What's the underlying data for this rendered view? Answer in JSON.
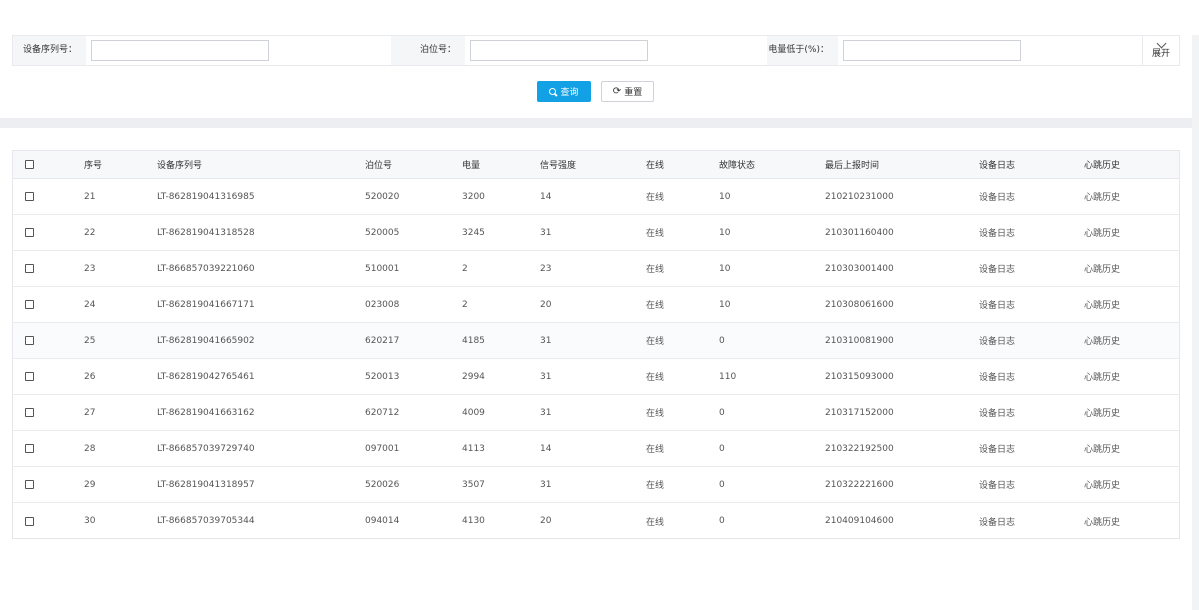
{
  "filters": {
    "serial_label": "设备序列号：",
    "serial_value": "",
    "berth_label": "泊位号：",
    "berth_value": "",
    "battery_label": "电量低于(%)：",
    "battery_value": "",
    "expand_label": "展开",
    "expand_icon": "chevron-down-icon"
  },
  "actions": {
    "query_label": "查询",
    "query_icon": "search-icon",
    "reset_label": "重置",
    "reset_icon": "refresh-icon",
    "reset_glyph": "⟳"
  },
  "colors": {
    "primary": "#11a1e4",
    "header_bg": "#f7f8fa",
    "band_bg": "#eceef2"
  },
  "table": {
    "headers": [
      "序号",
      "设备序列号",
      "泊位号",
      "电量",
      "信号强度",
      "在线",
      "故障状态",
      "最后上报时间",
      "设备日志",
      "心跳历史"
    ],
    "rows": [
      [
        "21",
        "LT-862819041316985",
        "520020",
        "3200",
        "14",
        "在线",
        "10",
        "210210231000",
        "设备日志",
        "心跳历史"
      ],
      [
        "22",
        "LT-862819041318528",
        "520005",
        "3245",
        "31",
        "在线",
        "10",
        "210301160400",
        "设备日志",
        "心跳历史"
      ],
      [
        "23",
        "LT-866857039221060",
        "510001",
        "2",
        "23",
        "在线",
        "10",
        "210303001400",
        "设备日志",
        "心跳历史"
      ],
      [
        "24",
        "LT-862819041667171",
        "023008",
        "2",
        "20",
        "在线",
        "10",
        "210308061600",
        "设备日志",
        "心跳历史"
      ],
      [
        "25",
        "LT-862819041665902",
        "620217",
        "4185",
        "31",
        "在线",
        "0",
        "210310081900",
        "设备日志",
        "心跳历史"
      ],
      [
        "26",
        "LT-862819042765461",
        "520013",
        "2994",
        "31",
        "在线",
        "110",
        "210315093000",
        "设备日志",
        "心跳历史"
      ],
      [
        "27",
        "LT-862819041663162",
        "620712",
        "4009",
        "31",
        "在线",
        "0",
        "210317152000",
        "设备日志",
        "心跳历史"
      ],
      [
        "28",
        "LT-866857039729740",
        "097001",
        "4113",
        "14",
        "在线",
        "0",
        "210322192500",
        "设备日志",
        "心跳历史"
      ],
      [
        "29",
        "LT-862819041318957",
        "520026",
        "3507",
        "31",
        "在线",
        "0",
        "210322221600",
        "设备日志",
        "心跳历史"
      ],
      [
        "30",
        "LT-866857039705344",
        "094014",
        "4130",
        "20",
        "在线",
        "0",
        "210409104600",
        "设备日志",
        "心跳历史"
      ]
    ]
  }
}
